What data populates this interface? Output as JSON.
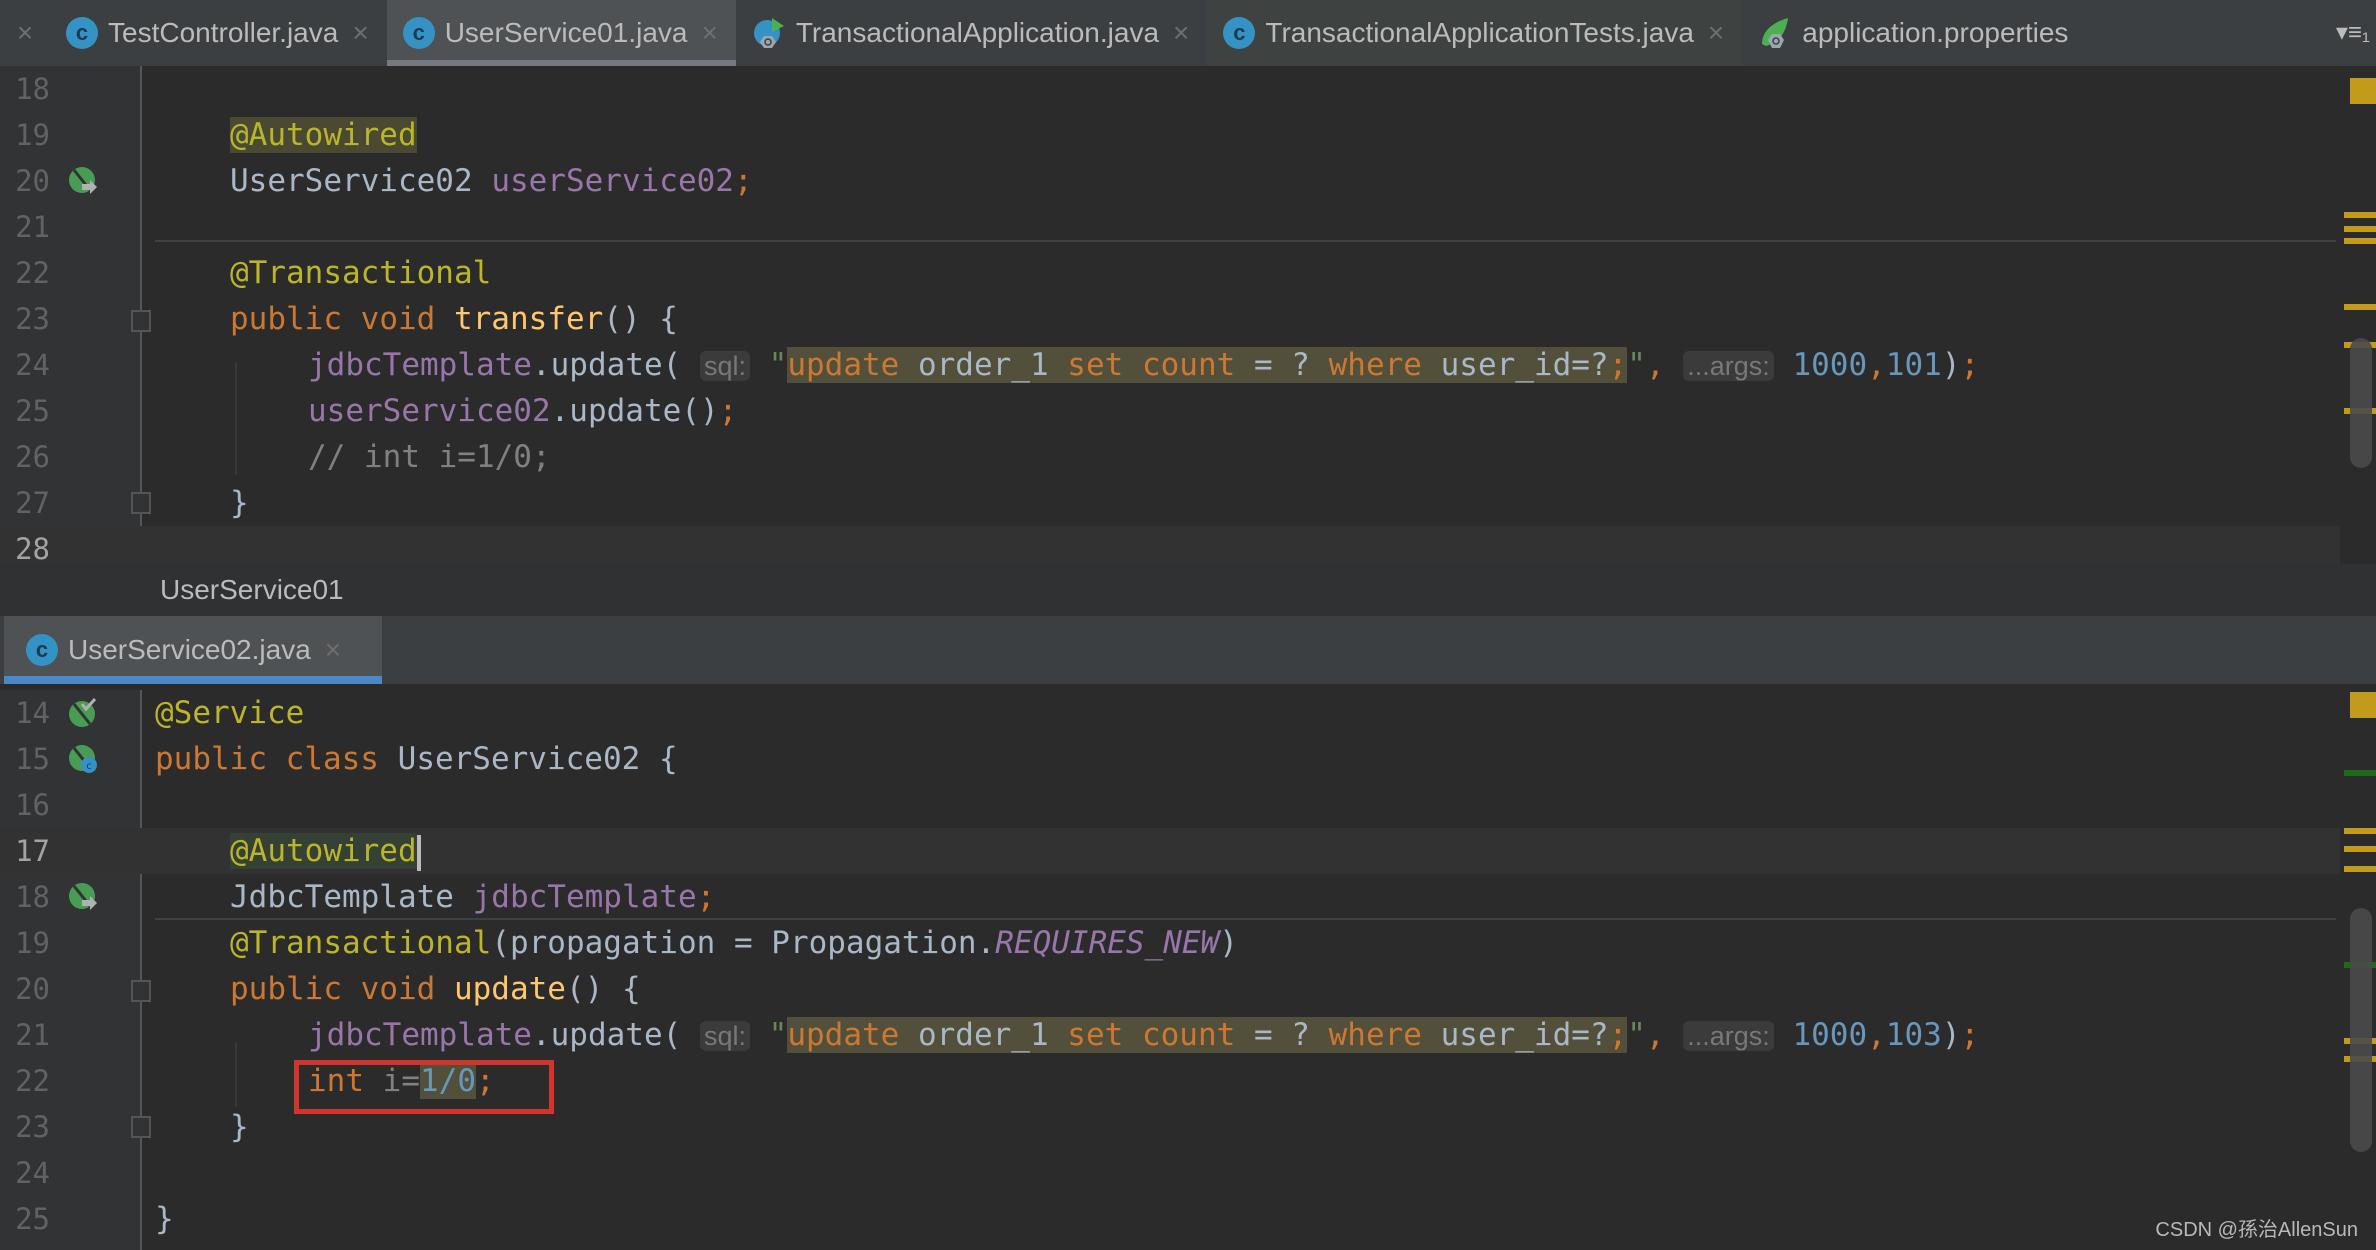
{
  "tabs": {
    "close_first": "×",
    "items": [
      {
        "label": "TestController.java",
        "icon": "class-icon",
        "active": false
      },
      {
        "label": "UserService01.java",
        "icon": "class-icon",
        "active": true
      },
      {
        "label": "TransactionalApplication.java",
        "icon": "spring-boot-app-icon",
        "active": false
      },
      {
        "label": "TransactionalApplicationTests.java",
        "icon": "class-icon",
        "active": false
      },
      {
        "label": "application.properties",
        "icon": "spring-properties-icon",
        "active": false
      }
    ],
    "close_glyph": "×",
    "class_glyph": "c",
    "overflow_menu": "▾≡₁"
  },
  "editor1": {
    "lines": [
      {
        "n": "18"
      },
      {
        "n": "19",
        "annotation": "@Autowired"
      },
      {
        "n": "20",
        "type": "UserService02",
        "field": "userService02",
        "semi": ";"
      },
      {
        "n": "21"
      },
      {
        "n": "22",
        "annotation": "@Transactional"
      },
      {
        "n": "23",
        "kw1": "public",
        "kw2": "void",
        "method": "transfer",
        "rest": "() {"
      },
      {
        "n": "24",
        "obj": "jdbcTemplate",
        "call": ".update(",
        "hint_sql": "sql:",
        "quote_open": "\"",
        "sql_parts": [
          "update",
          " order_1 ",
          "set",
          " ",
          "count",
          " = ? ",
          "where",
          " user_id=?",
          ";"
        ],
        "quote_close": "\"",
        "comma": ",",
        "hint_args": "...args:",
        "arg1": "1000",
        "arg_comma": ",",
        "arg2": "101",
        "close": ")",
        "semi": ";"
      },
      {
        "n": "25",
        "obj": "userService02",
        "call": ".update()",
        "semi": ";"
      },
      {
        "n": "26",
        "comment": "// int i=1/0;"
      },
      {
        "n": "27",
        "brace": "}"
      },
      {
        "n": "28"
      }
    ]
  },
  "breadcrumb": "UserService01",
  "tab2": {
    "label": "UserService02.java",
    "glyph": "c",
    "close": "×"
  },
  "editor2": {
    "lines": [
      {
        "n": "14",
        "annotation": "@Service"
      },
      {
        "n": "15",
        "kw1": "public",
        "kw2": "class",
        "name": "UserService02",
        "rest": " {"
      },
      {
        "n": "16"
      },
      {
        "n": "17",
        "annotation": "@Autowired"
      },
      {
        "n": "18",
        "type": "JdbcTemplate",
        "field": "jdbcTemplate",
        "semi": ";"
      },
      {
        "n": "19",
        "annotation": "@Transactional",
        "open": "(",
        "param": "propagation",
        "eq": " = ",
        "cls": "Propagation.",
        "const": "REQUIRES_NEW",
        "close": ")"
      },
      {
        "n": "20",
        "kw1": "public",
        "kw2": "void",
        "method": "update",
        "rest": "() {"
      },
      {
        "n": "21",
        "obj": "jdbcTemplate",
        "call": ".update(",
        "hint_sql": "sql:",
        "quote_open": "\"",
        "sql_parts": [
          "update",
          " order_1 ",
          "set",
          " ",
          "count",
          " = ? ",
          "where",
          " user_id=?",
          ";"
        ],
        "quote_close": "\"",
        "comma": ",",
        "hint_args": "...args:",
        "arg1": "1000",
        "arg_comma": ",",
        "arg2": "103",
        "close": ")",
        "semi": ";"
      },
      {
        "n": "22",
        "kw": "int",
        "var": " i=",
        "expr": "1/0",
        "semi": ";"
      },
      {
        "n": "23",
        "brace": "}"
      },
      {
        "n": "24"
      },
      {
        "n": "25",
        "brace": "}"
      }
    ]
  },
  "watermark": "CSDN @孫治AllenSun"
}
